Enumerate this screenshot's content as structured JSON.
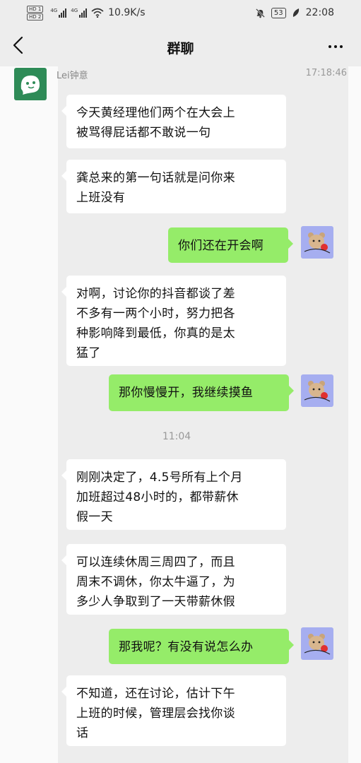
{
  "statusbar": {
    "hd_top": "HD 1",
    "hd_bottom": "HD 2",
    "net1": "4G",
    "net2": "4G",
    "speed": "10.9K/s",
    "battery": "53",
    "time": "22:08"
  },
  "nav": {
    "title": "群聊"
  },
  "chat": {
    "first_sender": "Lei钟意",
    "first_time": "17:18:46",
    "mid_time": "11:04",
    "messages": [
      {
        "side": "in",
        "lines": [
          "今天黄经理他们两个在大会上",
          "被骂得屁话都不敢说一句"
        ]
      },
      {
        "side": "in",
        "lines": [
          "龚总来的第一句话就是问你来",
          "上班没有"
        ]
      },
      {
        "side": "out",
        "lines": [
          "你们还在开会啊"
        ]
      },
      {
        "side": "in",
        "lines": [
          "对啊，讨论你的抖音都谈了差",
          "不多有一两个小时，努力把各",
          "种影响降到最低，你真的是太",
          "猛了"
        ]
      },
      {
        "side": "out",
        "lines": [
          "那你慢慢开，我继续摸鱼"
        ]
      },
      {
        "side": "in",
        "lines": [
          "刚刚决定了，4.5号所有上个月",
          "加班超过48小时的，都带薪休",
          "假一天"
        ]
      },
      {
        "side": "in",
        "lines": [
          "可以连续休周三周四了，而且",
          "周末不调休，你太牛逼了，为",
          "多少人争取到了一天带薪休假"
        ]
      },
      {
        "side": "out",
        "lines": [
          "那我呢？有没有说怎么办"
        ]
      },
      {
        "side": "in",
        "lines": [
          "不知道，还在讨论，估计下午",
          "上班的时候，管理层会找你谈",
          "话"
        ]
      }
    ]
  },
  "colors": {
    "bg": "#ededed",
    "incoming_bubble": "#ffffff",
    "outgoing_bubble": "#95ec69",
    "contact_avatar": "#2e8b57",
    "my_avatar": "#a6aef0"
  }
}
